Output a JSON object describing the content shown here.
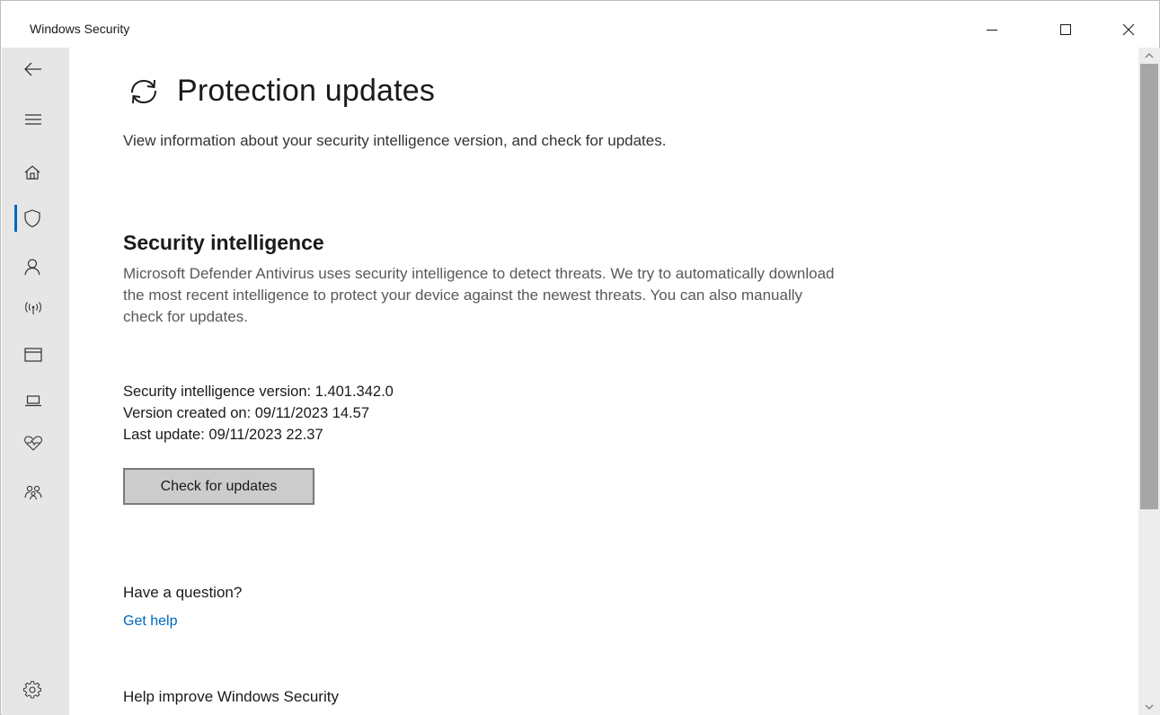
{
  "window": {
    "title": "Windows Security"
  },
  "caption_buttons": {
    "minimize_icon": "minimize-icon",
    "maximize_icon": "maximize-icon",
    "close_icon": "close-icon"
  },
  "sidebar": {
    "items": [
      {
        "id": "back",
        "icon": "back-arrow-icon"
      },
      {
        "id": "menu",
        "icon": "hamburger-menu-icon"
      },
      {
        "id": "home",
        "icon": "home-icon"
      },
      {
        "id": "virus-protection",
        "icon": "shield-icon",
        "active": true
      },
      {
        "id": "account-protection",
        "icon": "person-icon"
      },
      {
        "id": "firewall",
        "icon": "antenna-icon"
      },
      {
        "id": "app-browser-control",
        "icon": "browser-window-icon"
      },
      {
        "id": "device-security",
        "icon": "laptop-icon"
      },
      {
        "id": "device-performance",
        "icon": "heart-pulse-icon"
      },
      {
        "id": "family-options",
        "icon": "family-icon"
      },
      {
        "id": "settings",
        "icon": "gear-icon"
      }
    ],
    "accent_color": "#0067c0"
  },
  "main": {
    "page_title": "Protection updates",
    "page_description": "View information about your security intelligence version, and check for updates.",
    "section_title": "Security intelligence",
    "section_description": "Microsoft Defender Antivirus uses security intelligence to detect threats. We try to automatically download the most recent intelligence to protect your device against the newest threats. You can also manually check for updates.",
    "version_line": "Security intelligence version: 1.401.342.0",
    "created_line": "Version created on: 09/11/2023 14.57",
    "last_update_line": "Last update: 09/11/2023 22.37",
    "check_button_label": "Check for updates",
    "question_heading": "Have a question?",
    "help_link": "Get help",
    "improve_heading": "Help improve Windows Security"
  },
  "colors": {
    "link": "#0067c0",
    "sidebar_bg": "#e6e6e6",
    "button_bg": "#cccccc"
  }
}
